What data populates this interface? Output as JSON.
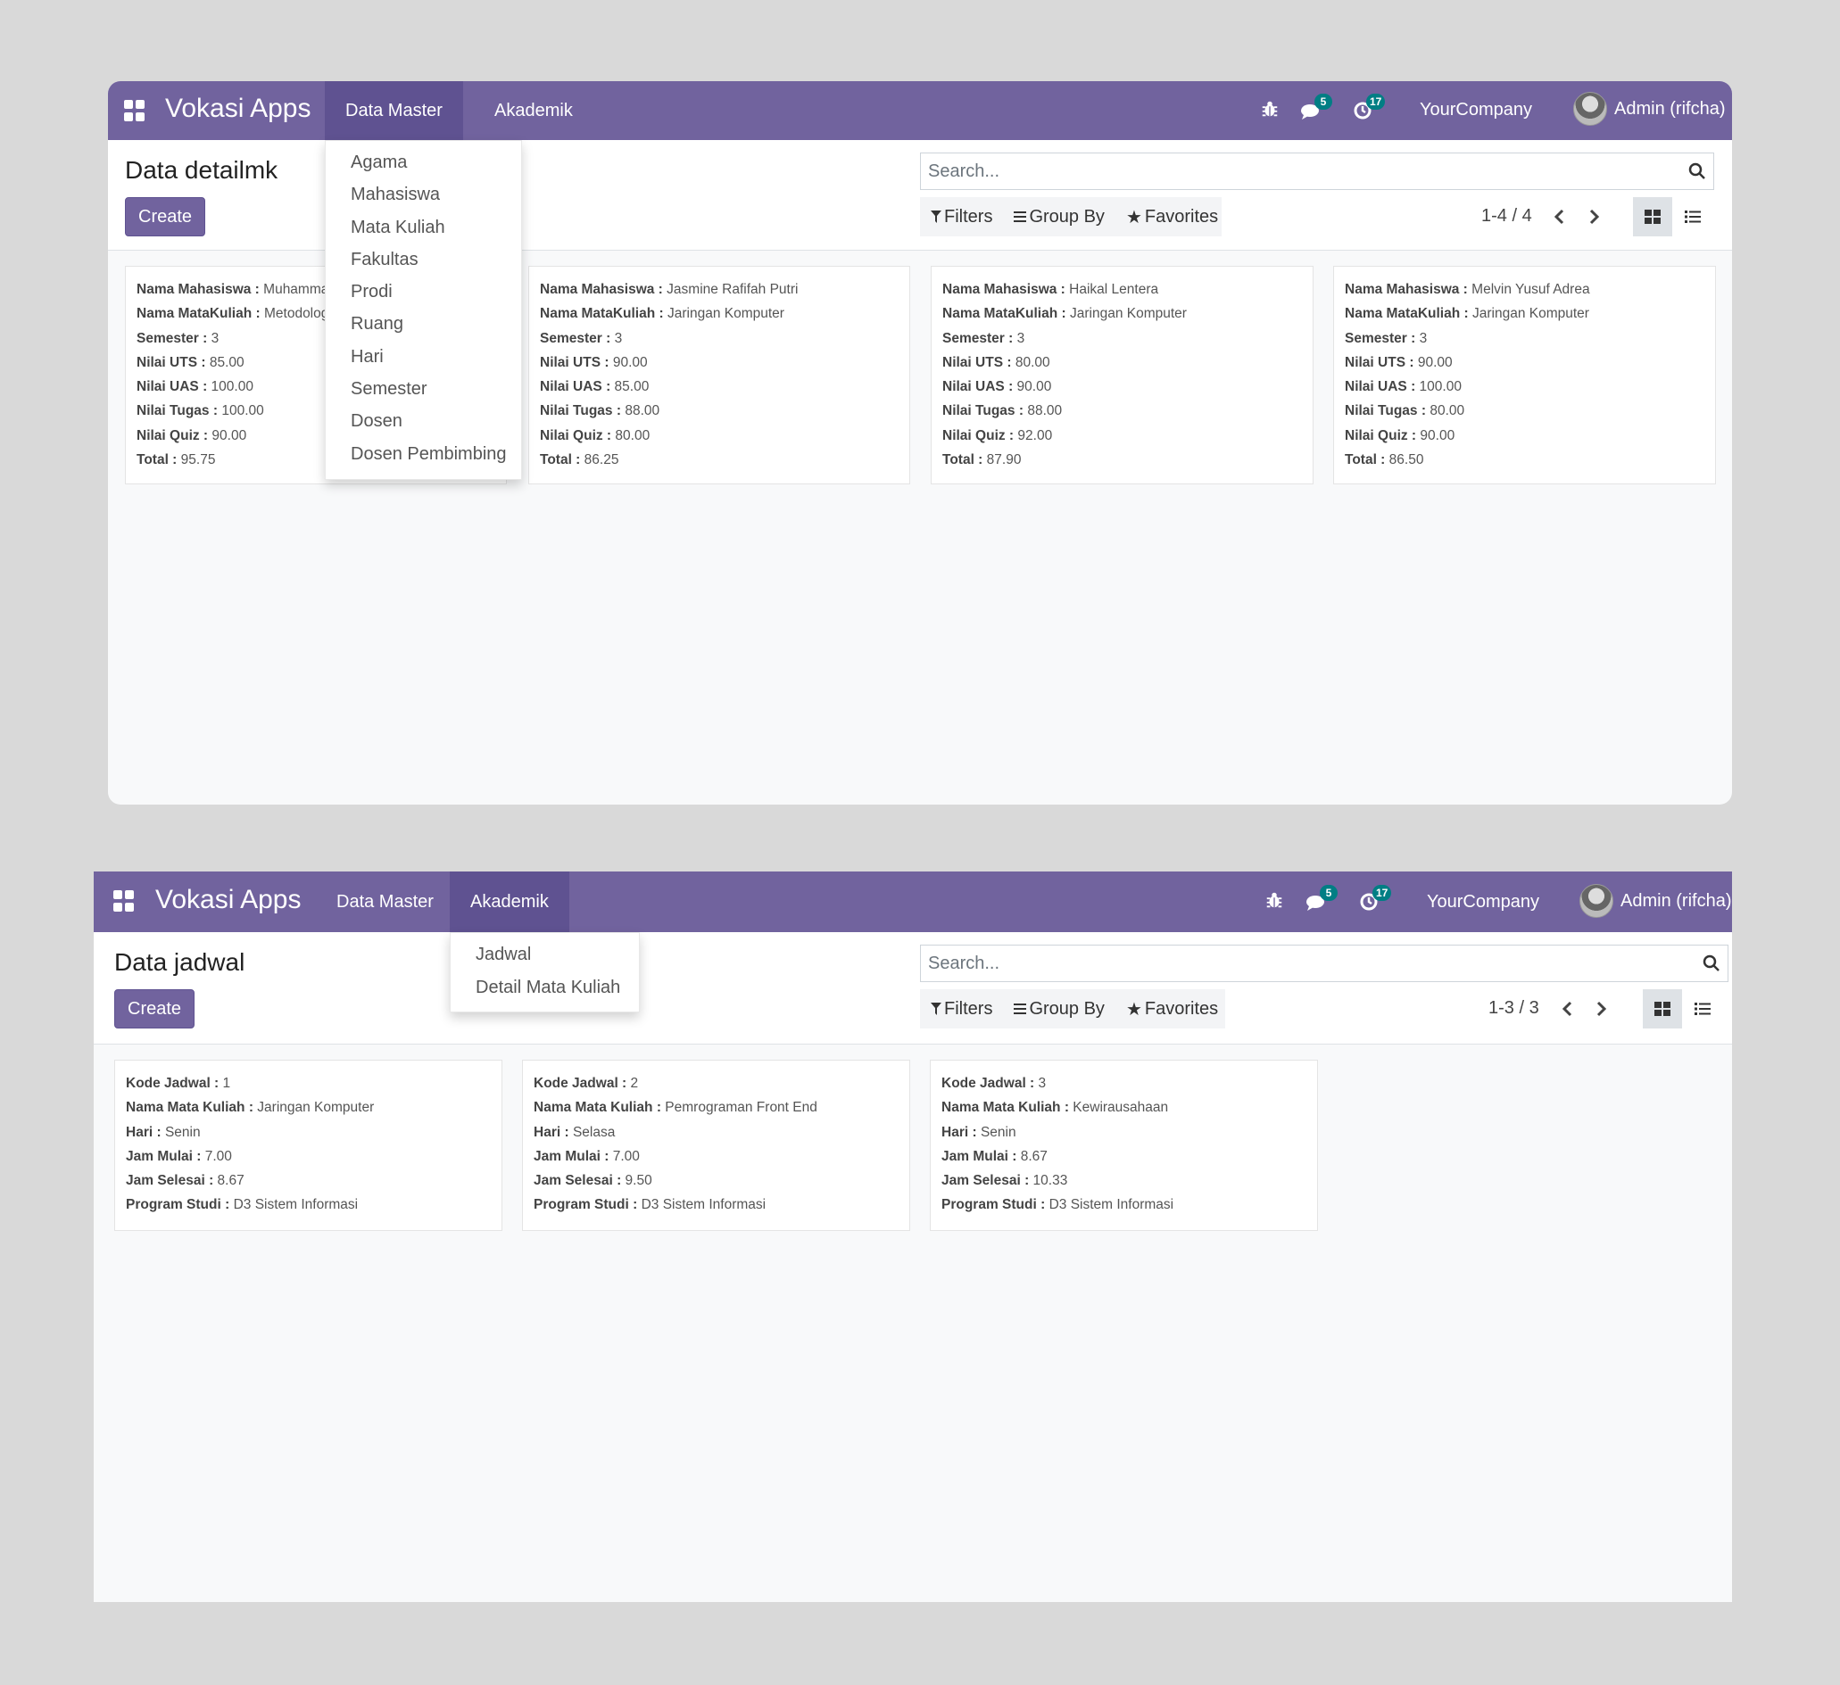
{
  "colors": {
    "brand": "#71639e",
    "badge": "#017e84"
  },
  "window1": {
    "app_name": "Vokasi Apps",
    "menus": [
      "Data Master",
      "Akademik"
    ],
    "active_menu": "Data Master",
    "messages_badge": "5",
    "activities_badge": "17",
    "company": "YourCompany",
    "user": "Admin (rifcha)",
    "title": "Data detailmk",
    "create_label": "Create",
    "search_placeholder": "Search...",
    "filters_label": "Filters",
    "groupby_label": "Group By",
    "favorites_label": "Favorites",
    "pager": "1-4 / 4",
    "dropdown": [
      "Agama",
      "Mahasiswa",
      "Mata Kuliah",
      "Fakultas",
      "Prodi",
      "Ruang",
      "Hari",
      "Semester",
      "Dosen",
      "Dosen Pembimbing"
    ],
    "cards": [
      {
        "fields": [
          [
            "Nama Mahasiswa",
            "Muhammad"
          ],
          [
            "Nama MataKuliah",
            "Metodologi"
          ],
          [
            "Semester",
            "3"
          ],
          [
            "Nilai UTS",
            "85.00"
          ],
          [
            "Nilai UAS",
            "100.00"
          ],
          [
            "Nilai Tugas",
            "100.00"
          ],
          [
            "Nilai Quiz",
            "90.00"
          ],
          [
            "Total",
            "95.75"
          ]
        ]
      },
      {
        "fields": [
          [
            "Nama Mahasiswa",
            "Jasmine Rafifah Putri"
          ],
          [
            "Nama MataKuliah",
            "Jaringan Komputer"
          ],
          [
            "Semester",
            "3"
          ],
          [
            "Nilai UTS",
            "90.00"
          ],
          [
            "Nilai UAS",
            "85.00"
          ],
          [
            "Nilai Tugas",
            "88.00"
          ],
          [
            "Nilai Quiz",
            "80.00"
          ],
          [
            "Total",
            "86.25"
          ]
        ]
      },
      {
        "fields": [
          [
            "Nama Mahasiswa",
            "Haikal Lentera"
          ],
          [
            "Nama MataKuliah",
            "Jaringan Komputer"
          ],
          [
            "Semester",
            "3"
          ],
          [
            "Nilai UTS",
            "80.00"
          ],
          [
            "Nilai UAS",
            "90.00"
          ],
          [
            "Nilai Tugas",
            "88.00"
          ],
          [
            "Nilai Quiz",
            "92.00"
          ],
          [
            "Total",
            "87.90"
          ]
        ]
      },
      {
        "fields": [
          [
            "Nama Mahasiswa",
            "Melvin Yusuf Adrea"
          ],
          [
            "Nama MataKuliah",
            "Jaringan Komputer"
          ],
          [
            "Semester",
            "3"
          ],
          [
            "Nilai UTS",
            "90.00"
          ],
          [
            "Nilai UAS",
            "100.00"
          ],
          [
            "Nilai Tugas",
            "80.00"
          ],
          [
            "Nilai Quiz",
            "90.00"
          ],
          [
            "Total",
            "86.50"
          ]
        ]
      }
    ]
  },
  "window2": {
    "app_name": "Vokasi Apps",
    "menus": [
      "Data Master",
      "Akademik"
    ],
    "active_menu": "Akademik",
    "messages_badge": "5",
    "activities_badge": "17",
    "company": "YourCompany",
    "user": "Admin (rifcha)",
    "title": "Data jadwal",
    "create_label": "Create",
    "search_placeholder": "Search...",
    "filters_label": "Filters",
    "groupby_label": "Group By",
    "favorites_label": "Favorites",
    "pager": "1-3 / 3",
    "dropdown": [
      "Jadwal",
      "Detail Mata Kuliah"
    ],
    "cards": [
      {
        "fields": [
          [
            "Kode Jadwal",
            "1"
          ],
          [
            "Nama Mata Kuliah",
            "Jaringan Komputer"
          ],
          [
            "Hari",
            "Senin"
          ],
          [
            "Jam Mulai",
            "7.00"
          ],
          [
            "Jam Selesai",
            "8.67"
          ],
          [
            "Program Studi",
            "D3 Sistem Informasi"
          ]
        ]
      },
      {
        "fields": [
          [
            "Kode Jadwal",
            "2"
          ],
          [
            "Nama Mata Kuliah",
            "Pemrograman Front End"
          ],
          [
            "Hari",
            "Selasa"
          ],
          [
            "Jam Mulai",
            "7.00"
          ],
          [
            "Jam Selesai",
            "9.50"
          ],
          [
            "Program Studi",
            "D3 Sistem Informasi"
          ]
        ]
      },
      {
        "fields": [
          [
            "Kode Jadwal",
            "3"
          ],
          [
            "Nama Mata Kuliah",
            "Kewirausahaan"
          ],
          [
            "Hari",
            "Senin"
          ],
          [
            "Jam Mulai",
            "8.67"
          ],
          [
            "Jam Selesai",
            "10.33"
          ],
          [
            "Program Studi",
            "D3 Sistem Informasi"
          ]
        ]
      }
    ]
  }
}
